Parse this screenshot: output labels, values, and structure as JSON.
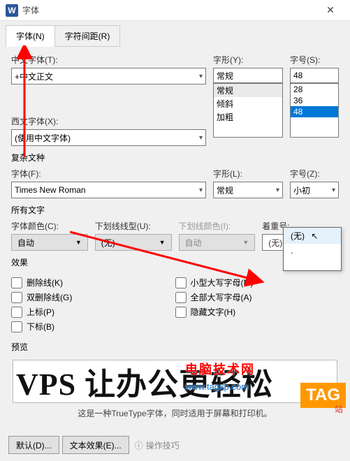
{
  "titlebar": {
    "icon_label": "W",
    "title": "字体"
  },
  "tabs": {
    "font": "字体(N)",
    "spacing": "字符间距(R)"
  },
  "cn_section": {
    "cn_font_label": "中文字体(T):",
    "cn_font_value": "+中文正文",
    "western_font_label": "西文字体(X):",
    "western_font_value": "(使用中文字体)"
  },
  "style_section": {
    "label": "字形(Y):",
    "value": "常规",
    "options": [
      "常规",
      "倾斜",
      "加粗"
    ]
  },
  "size_section": {
    "label": "字号(S):",
    "value": "48",
    "options": [
      "28",
      "36",
      "48"
    ]
  },
  "complex_label": "复杂文种",
  "complex": {
    "font_label": "字体(F):",
    "font_value": "Times New Roman",
    "style_label": "字形(L):",
    "style_value": "常规",
    "size_label": "字号(Z):",
    "size_value": "小初"
  },
  "alltext_label": "所有文字",
  "color_label": "字体颜色(C):",
  "color_value": "自动",
  "underline_label": "下划线线型(U):",
  "underline_value": "(无)",
  "ulcolor_label": "下划线颜色(I):",
  "ulcolor_value": "自动",
  "emphasis_label": "着重号:",
  "emphasis_value": "(无)",
  "emphasis_popup": {
    "none": "(无)",
    "dot": "."
  },
  "effects_label": "效果",
  "effects": {
    "strike": "删除线(K)",
    "dblstrike": "双删除线(G)",
    "super": "上标(P)",
    "sub": "下标(B)",
    "smallcaps": "小型大写字母(M)",
    "allcaps": "全部大写字母(A)",
    "hidden": "隐藏文字(H)"
  },
  "preview_label": "预览",
  "preview_text": "VPS 让办公更轻松",
  "preview_desc": "这是一种TrueType字体，同时适用于屏幕和打印机。",
  "buttons": {
    "default_btn": "默认(D)...",
    "text_effects": "文本效果(E)...",
    "op_tip": "操作技巧"
  },
  "overlay": {
    "brand": "电脑技术网",
    "url": "www.tagxp.com",
    "tag": "TAG",
    "tag_sub": "站"
  }
}
